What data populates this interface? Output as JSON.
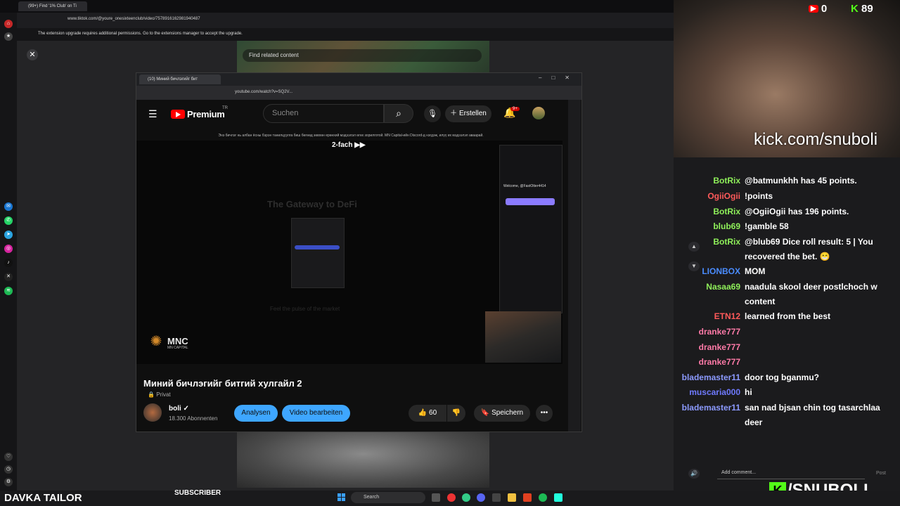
{
  "outer_browser": {
    "tab_title": "(99+) Find '1% Club' on Ti",
    "url": "www.tiktok.com/@youre_onesixteenclub/video/7578916162981940487",
    "notice": "The extension upgrade requires additional permissions. Go to the extensions manager to accept the upgrade.",
    "tiktok_search_placeholder": "Find related content"
  },
  "inner_browser": {
    "tab_title": "(10) Миний бичлэгийг бит",
    "url": "youtube.com/watch?v=SQ2V..."
  },
  "youtube": {
    "logo": "Premium",
    "region": "TR",
    "search_placeholder": "Suchen",
    "create_label": "Erstellen",
    "notifications_badge": "9+",
    "banner": "Энэ бичлэг нь албан ёсны бэрэн танилцуулга биш бөгөөд зөвхөн ерөнхий мэдээлэл өгөх зорилготой. MN Capital-ийн Discord-д нэгдэж, илүү их мэдээлэл аваарай.",
    "player": {
      "speed": "2-fach",
      "gateway_text": "The Gateway to DeFi",
      "feel_text": "Feel the pulse of the market",
      "wallet_welcome": "Welcome, @FastOtter4414",
      "mnc_logo": "MNC",
      "mnc_sub": "MN CAPITAL"
    },
    "video_title": "Миний бичлэгийг битгий хулгайл 2",
    "privacy": "Privat",
    "channel_name": "boli",
    "subscribers": "18.300 Abonnenten",
    "analysen_label": "Analysen",
    "edit_label": "Video bearbeiten",
    "like_count": "60",
    "save_label": "Speichern"
  },
  "stream": {
    "youtube_viewers": "0",
    "kick_viewers": "89",
    "kick_url": "kick.com/snuboli",
    "chat": [
      {
        "user": "BotRix",
        "msg": "@batmunkhh has 45 points.",
        "color": "#8ff05a"
      },
      {
        "user": "OgiiOgii",
        "msg": "!points",
        "color": "#ff5a5a"
      },
      {
        "user": "BotRix",
        "msg": "@OgiiOgii has 196 points.",
        "color": "#8ff05a"
      },
      {
        "user": "blub69",
        "msg": "!gamble 58",
        "color": "#8ff05a"
      },
      {
        "user": "BotRix",
        "msg": "@blub69 Dice roll result: 5 | You",
        "color": "#8ff05a"
      },
      {
        "user": "",
        "msg": "recovered the bet. 😁",
        "color": "#8ff05a"
      },
      {
        "user": "LIONBOX",
        "msg": "MOM",
        "color": "#4a8cff"
      },
      {
        "user": "Nasaa69",
        "msg": "naadula skool deer postlchoch w",
        "color": "#8ff05a"
      },
      {
        "user": "",
        "msg": "content",
        "color": "#8ff05a"
      },
      {
        "user": "ETN12",
        "msg": "learned from the best",
        "color": "#ff5a5a"
      },
      {
        "user": "dranke777",
        "msg": "",
        "color": "#ff7aa8"
      },
      {
        "user": "dranke777",
        "msg": "",
        "color": "#ff7aa8"
      },
      {
        "user": "dranke777",
        "msg": "",
        "color": "#ff7aa8"
      },
      {
        "user": "blademaster11",
        "msg": "door tog bganmu?",
        "color": "#8c9aff"
      },
      {
        "user": "muscaria000",
        "msg": "hi",
        "color": "#6f7aff"
      },
      {
        "user": "blademaster11",
        "msg": "san nad bjsan chin tog tasarchlaa",
        "color": "#8c9aff"
      },
      {
        "user": "",
        "msg": "deer",
        "color": "#8c9aff"
      }
    ],
    "comment_placeholder": "Add comment...",
    "post_label": "Post",
    "banner_name": "/SNUBOLI",
    "overlay_name": "DAVKA TAILOR",
    "subscriber_label": "SUBSCRIBER"
  },
  "taskbar": {
    "search_label": "Search"
  }
}
